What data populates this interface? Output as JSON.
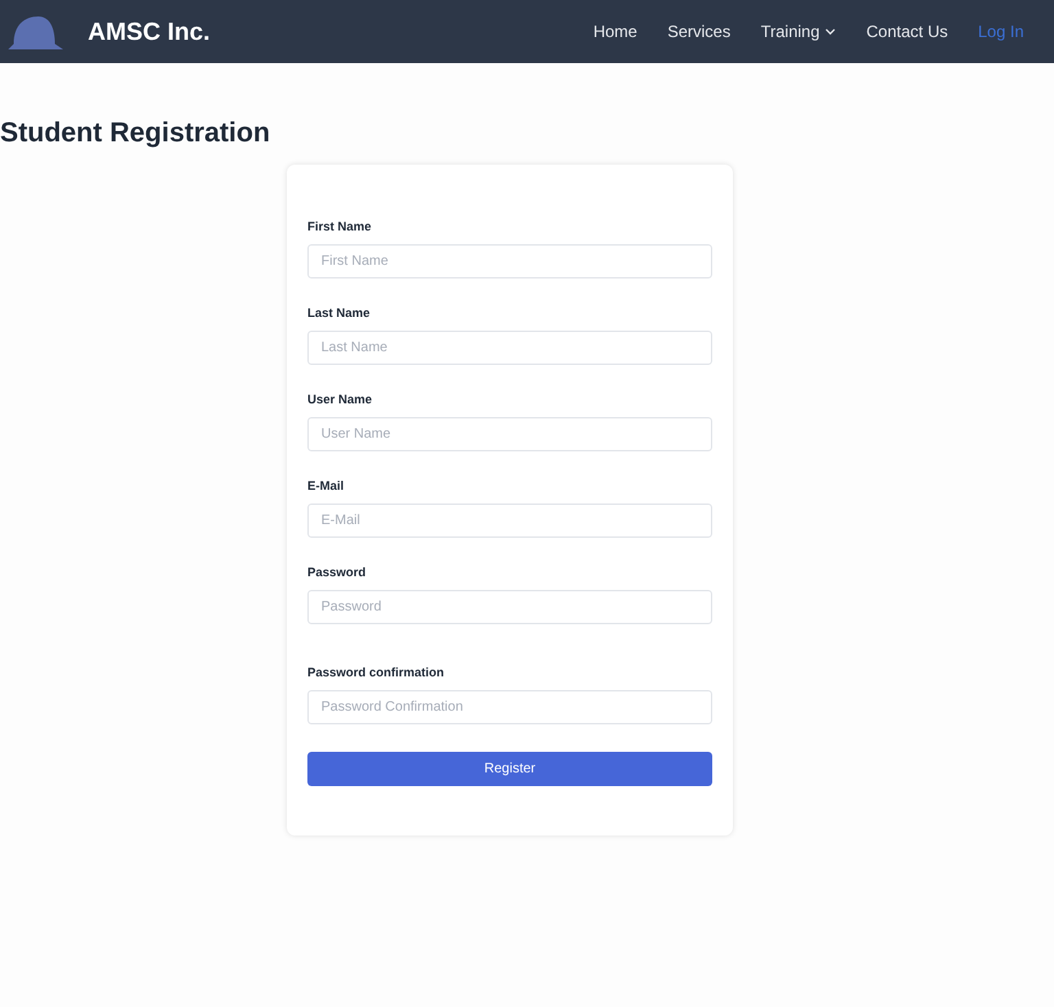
{
  "brand": {
    "name": "AMSC Inc."
  },
  "nav": [
    {
      "label": "Home",
      "kind": "link"
    },
    {
      "label": "Services",
      "kind": "link"
    },
    {
      "label": "Training",
      "kind": "dropdown"
    },
    {
      "label": "Contact Us",
      "kind": "link"
    },
    {
      "label": "Log In",
      "kind": "accent"
    }
  ],
  "heading": "Student Registration",
  "form": {
    "fields": [
      {
        "label": "First Name",
        "placeholder": "First Name"
      },
      {
        "label": "Last Name",
        "placeholder": "Last Name"
      },
      {
        "label": "User Name",
        "placeholder": "User Name"
      },
      {
        "label": "E-Mail",
        "placeholder": "E-Mail"
      },
      {
        "label": "Password",
        "placeholder": "Password"
      },
      {
        "label": "Password confirmation",
        "placeholder": "Password Confirmation"
      }
    ],
    "submit": "Register"
  }
}
